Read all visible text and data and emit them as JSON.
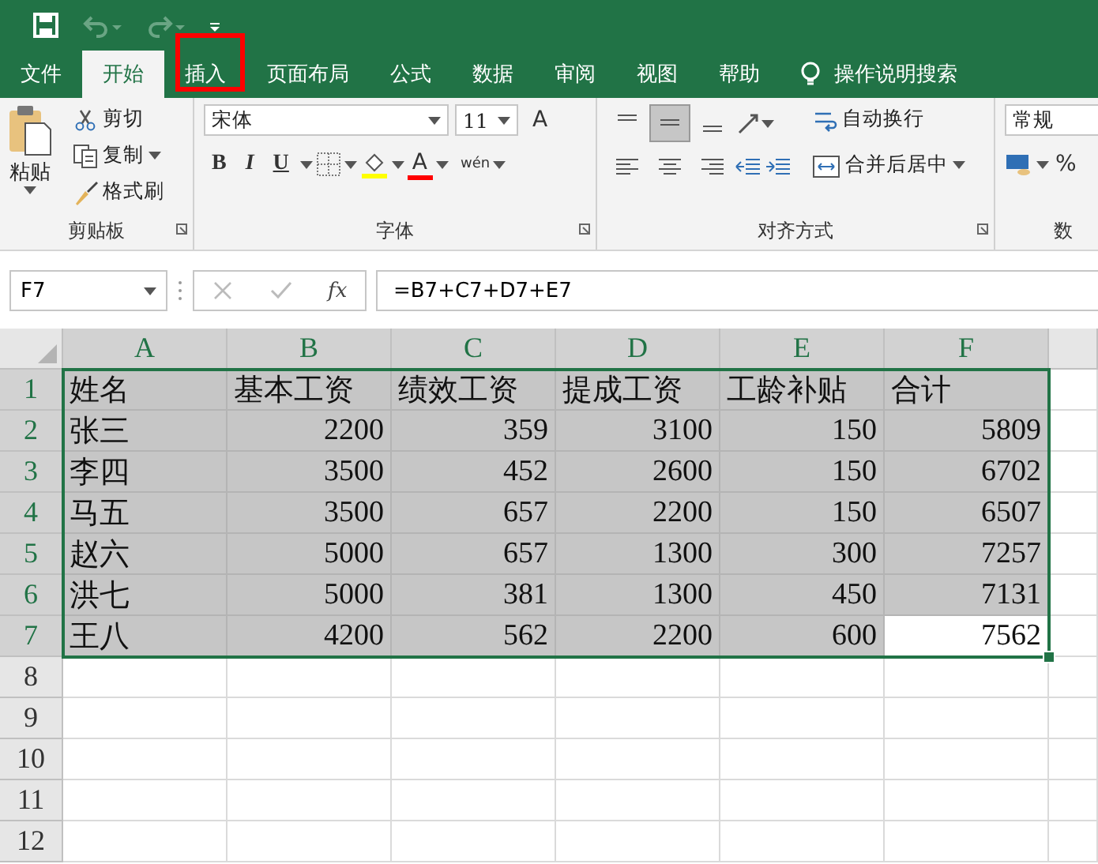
{
  "tabs": [
    {
      "label": "文件",
      "selected": false
    },
    {
      "label": "开始",
      "selected": true
    },
    {
      "label": "插入",
      "selected": false,
      "highlighted": true
    },
    {
      "label": "页面布局",
      "selected": false
    },
    {
      "label": "公式",
      "selected": false
    },
    {
      "label": "数据",
      "selected": false
    },
    {
      "label": "审阅",
      "selected": false
    },
    {
      "label": "视图",
      "selected": false
    },
    {
      "label": "帮助",
      "selected": false
    }
  ],
  "tell_me": {
    "placeholder": "操作说明搜索"
  },
  "ribbon": {
    "clipboard": {
      "label": "剪贴板",
      "paste": "粘贴",
      "cut": "剪切",
      "copy": "复制",
      "format_painter": "格式刷"
    },
    "font": {
      "label": "字体",
      "font_name": "宋体",
      "font_size": "11",
      "grow": "A",
      "bold": "B",
      "italic": "I",
      "underline": "U",
      "font_color": "A",
      "phonetic": "wén"
    },
    "alignment": {
      "label": "对齐方式",
      "vertical": [
        {
          "selected": false
        },
        {
          "selected": true
        },
        {
          "selected": false
        }
      ],
      "wrap_text": "自动换行",
      "merge_center": "合并后居中"
    },
    "number": {
      "label": "数",
      "format": "常规",
      "percent": "%"
    }
  },
  "formula_bar": {
    "name_box": "F7",
    "function_label": "fx",
    "formula": "=B7+C7+D7+E7"
  },
  "sheet": {
    "columns": [
      {
        "label": "A",
        "selected": true
      },
      {
        "label": "B",
        "selected": true
      },
      {
        "label": "C",
        "selected": true
      },
      {
        "label": "D",
        "selected": true
      },
      {
        "label": "E",
        "selected": true
      },
      {
        "label": "F",
        "selected": true
      }
    ],
    "rows": [
      {
        "header": "1",
        "selected": true,
        "cells": [
          {
            "text": "姓名",
            "kind": "text",
            "active": false
          },
          {
            "text": "基本工资",
            "kind": "text",
            "active": false
          },
          {
            "text": "绩效工资",
            "kind": "text",
            "active": false
          },
          {
            "text": "提成工资",
            "kind": "text",
            "active": false
          },
          {
            "text": "工龄补贴",
            "kind": "text",
            "active": false
          },
          {
            "text": "合计",
            "kind": "text",
            "active": false
          }
        ]
      },
      {
        "header": "2",
        "selected": true,
        "cells": [
          {
            "text": "张三",
            "kind": "text",
            "active": false
          },
          {
            "text": "2200",
            "kind": "number",
            "active": false
          },
          {
            "text": "359",
            "kind": "number",
            "active": false
          },
          {
            "text": "3100",
            "kind": "number",
            "active": false
          },
          {
            "text": "150",
            "kind": "number",
            "active": false
          },
          {
            "text": "5809",
            "kind": "number",
            "active": false
          }
        ]
      },
      {
        "header": "3",
        "selected": true,
        "cells": [
          {
            "text": "李四",
            "kind": "text",
            "active": false
          },
          {
            "text": "3500",
            "kind": "number",
            "active": false
          },
          {
            "text": "452",
            "kind": "number",
            "active": false
          },
          {
            "text": "2600",
            "kind": "number",
            "active": false
          },
          {
            "text": "150",
            "kind": "number",
            "active": false
          },
          {
            "text": "6702",
            "kind": "number",
            "active": false
          }
        ]
      },
      {
        "header": "4",
        "selected": true,
        "cells": [
          {
            "text": "马五",
            "kind": "text",
            "active": false
          },
          {
            "text": "3500",
            "kind": "number",
            "active": false
          },
          {
            "text": "657",
            "kind": "number",
            "active": false
          },
          {
            "text": "2200",
            "kind": "number",
            "active": false
          },
          {
            "text": "150",
            "kind": "number",
            "active": false
          },
          {
            "text": "6507",
            "kind": "number",
            "active": false
          }
        ]
      },
      {
        "header": "5",
        "selected": true,
        "cells": [
          {
            "text": "赵六",
            "kind": "text",
            "active": false
          },
          {
            "text": "5000",
            "kind": "number",
            "active": false
          },
          {
            "text": "657",
            "kind": "number",
            "active": false
          },
          {
            "text": "1300",
            "kind": "number",
            "active": false
          },
          {
            "text": "300",
            "kind": "number",
            "active": false
          },
          {
            "text": "7257",
            "kind": "number",
            "active": false
          }
        ]
      },
      {
        "header": "6",
        "selected": true,
        "cells": [
          {
            "text": "洪七",
            "kind": "text",
            "active": false
          },
          {
            "text": "5000",
            "kind": "number",
            "active": false
          },
          {
            "text": "381",
            "kind": "number",
            "active": false
          },
          {
            "text": "1300",
            "kind": "number",
            "active": false
          },
          {
            "text": "450",
            "kind": "number",
            "active": false
          },
          {
            "text": "7131",
            "kind": "number",
            "active": false
          }
        ]
      },
      {
        "header": "7",
        "selected": true,
        "cells": [
          {
            "text": "王八",
            "kind": "text",
            "active": false
          },
          {
            "text": "4200",
            "kind": "number",
            "active": false
          },
          {
            "text": "562",
            "kind": "number",
            "active": false
          },
          {
            "text": "2200",
            "kind": "number",
            "active": false
          },
          {
            "text": "600",
            "kind": "number",
            "active": false
          },
          {
            "text": "7562",
            "kind": "number",
            "active": true
          }
        ]
      },
      {
        "header": "8",
        "selected": false
      },
      {
        "header": "9",
        "selected": false
      },
      {
        "header": "10",
        "selected": false
      },
      {
        "header": "11",
        "selected": false
      },
      {
        "header": "12",
        "selected": false
      }
    ]
  }
}
